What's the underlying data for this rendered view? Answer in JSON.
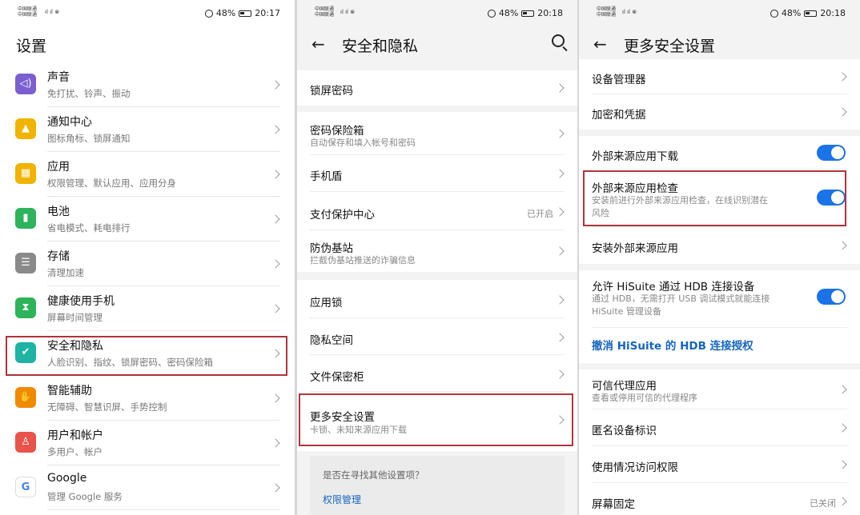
{
  "panel1": {
    "status": {
      "carrier_lines": [
        "中国联通",
        "中国联通"
      ],
      "signal": "4G ⁴ᴳ",
      "battery": "48%",
      "time": "20:17"
    },
    "title": "设置",
    "items": [
      {
        "title": "声音",
        "sub": "免打扰、铃声、振动",
        "icon": "speaker-icon",
        "glyph": "◁)",
        "color": "#7b5fd1"
      },
      {
        "title": "通知中心",
        "sub": "图标角标、锁屏通知",
        "icon": "bell-icon",
        "glyph": "▲",
        "color": "#f0b400"
      },
      {
        "title": "应用",
        "sub": "权限管理、默认应用、应用分身",
        "icon": "apps-grid-icon",
        "glyph": "▦",
        "color": "#f0b400"
      },
      {
        "title": "电池",
        "sub": "省电模式、耗电排行",
        "icon": "battery-icon",
        "glyph": "▮",
        "color": "#2db35a"
      },
      {
        "title": "存储",
        "sub": "清理加速",
        "icon": "storage-icon",
        "glyph": "☰",
        "color": "#8a8a8a"
      },
      {
        "title": "健康使用手机",
        "sub": "屏幕时间管理",
        "icon": "hourglass-icon",
        "glyph": "⧗",
        "color": "#2db35a"
      },
      {
        "title": "安全和隐私",
        "sub": "人脸识别、指纹、锁屏密码、密码保险箱",
        "icon": "shield-icon",
        "glyph": "✔",
        "color": "#1fb3a3"
      },
      {
        "title": "智能辅助",
        "sub": "无障碍、智慧识屏、手势控制",
        "icon": "hand-icon",
        "glyph": "✋",
        "color": "#f08a00"
      },
      {
        "title": "用户和帐户",
        "sub": "多用户、帐户",
        "icon": "user-icon",
        "glyph": "♙",
        "color": "#e8534a"
      },
      {
        "title": "Google",
        "sub": "管理 Google 服务",
        "icon": "google-icon",
        "glyph": "G",
        "color": "#ffffff"
      }
    ]
  },
  "panel2": {
    "status": {
      "carrier_lines": [
        "中国联通",
        "中国联通"
      ],
      "signal": "4G ⁴ᴳ",
      "battery": "48%",
      "time": "20:18"
    },
    "title": "安全和隐私",
    "lock_password": "锁屏密码",
    "group1": [
      {
        "title": "密码保险箱",
        "sub": "自动保存和填入帐号和密码"
      },
      {
        "title": "手机盾",
        "sub": ""
      },
      {
        "title": "支付保护中心",
        "sub": "",
        "value": "已开启"
      },
      {
        "title": "防伪基站",
        "sub": "拦截伪基站推送的诈骗信息"
      }
    ],
    "group2": [
      {
        "title": "应用锁"
      },
      {
        "title": "隐私空间"
      },
      {
        "title": "文件保密柜"
      },
      {
        "title": "更多安全设置",
        "sub": "卡锁、未知来源应用下载"
      }
    ],
    "suggest": {
      "question": "是否在寻找其他设置项？",
      "link": "权限管理"
    }
  },
  "panel3": {
    "status": {
      "carrier_lines": [
        "中国联通",
        "中国联通"
      ],
      "signal": "4G ⁴ᴳ",
      "battery": "48%",
      "time": "20:18"
    },
    "title": "更多安全设置",
    "group1": [
      {
        "title": "设备管理器"
      },
      {
        "title": "加密和凭据"
      }
    ],
    "ext_download": "外部来源应用下载",
    "ext_check": {
      "title": "外部来源应用检查",
      "sub_line1": "安装前进行外部来源应用检查，在线识别潜在",
      "sub_line2": "风险"
    },
    "ext_install": "安装外部来源应用",
    "hisuite": {
      "title": "允许 HiSuite 通过 HDB 连接设备",
      "sub_line1": "通过 HDB，无需打开 USB 调试模式就能连接",
      "sub_line2": "HiSuite 管理设备"
    },
    "revoke": "撤消 HiSuite 的 HDB 连接授权",
    "trusted": {
      "title": "可信代理应用",
      "sub": "查看或停用可信的代理程序"
    },
    "anon_id": "匿名设备标识",
    "usage_access": "使用情况访问权限",
    "screen_pin": {
      "title": "屏幕固定",
      "value": "已关闭"
    }
  }
}
